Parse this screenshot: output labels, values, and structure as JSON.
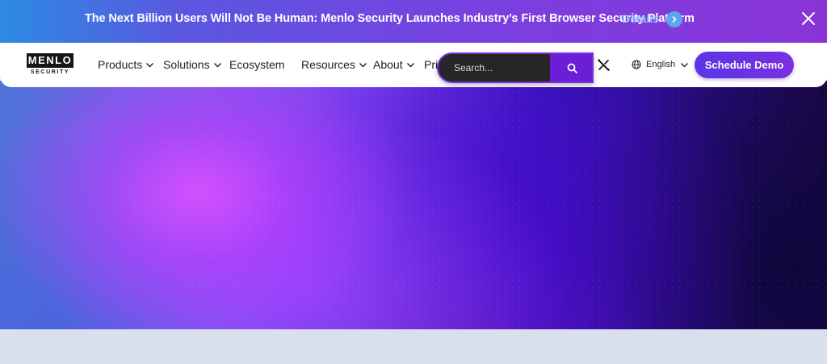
{
  "banner": {
    "text": "The Next Billion Users Will Not Be Human: Menlo Security Launches Industry’s First Browser Security Platform",
    "link_label": "Details",
    "arrow_icon": "chevron-right-icon",
    "close_icon": "close-icon"
  },
  "logo": {
    "top": "MENLO",
    "bottom": "SECURITY"
  },
  "nav": {
    "items": [
      {
        "label": "Products",
        "has_dropdown": true
      },
      {
        "label": "Solutions",
        "has_dropdown": true
      },
      {
        "label": "Ecosystem",
        "has_dropdown": false
      },
      {
        "label": "Resources",
        "has_dropdown": true
      },
      {
        "label": "About",
        "has_dropdown": true
      },
      {
        "label": "Pri",
        "has_dropdown": false
      }
    ]
  },
  "search": {
    "placeholder": "Search...",
    "button_icon": "search-icon"
  },
  "utility": {
    "x_icon": "x-social-icon",
    "language_label": "English",
    "language_icon": "globe-icon",
    "demo_label": "Schedule Demo"
  },
  "colors": {
    "banner_start": "#2b8be2",
    "banner_end": "#8a34d8",
    "accent": "#6a1fd6",
    "link": "#8fc3ff",
    "page_bottom": "#d9dfec"
  }
}
